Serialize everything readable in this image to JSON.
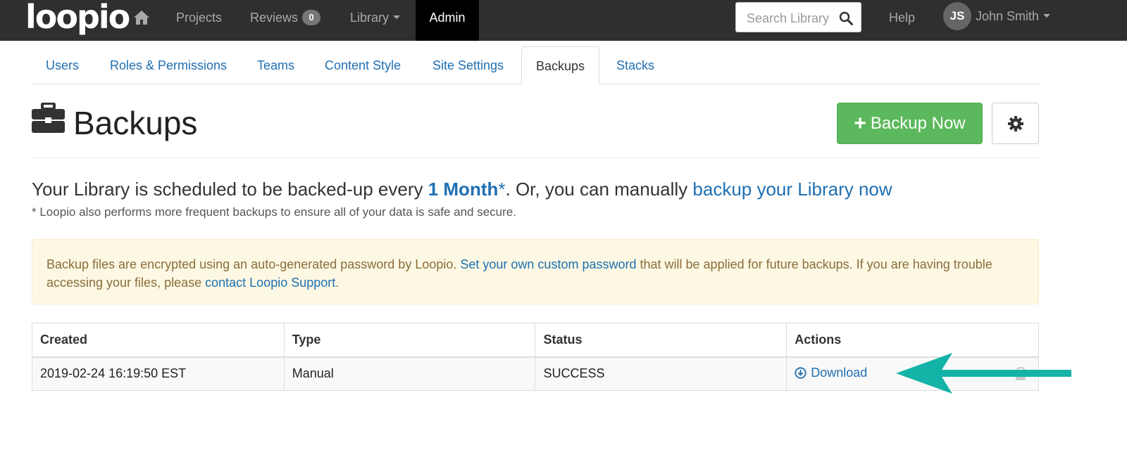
{
  "navbar": {
    "logo": "loopio",
    "items": {
      "projects": "Projects",
      "reviews": "Reviews",
      "reviews_count": "0",
      "library": "Library",
      "admin": "Admin",
      "help": "Help"
    },
    "search": {
      "placeholder": "Search Library"
    },
    "user": {
      "initials": "JS",
      "name": "John Smith"
    },
    "icons": [
      "home-icon",
      "search-icon",
      "chevron-down-icon"
    ]
  },
  "tabs": [
    {
      "label": "Users",
      "active": false
    },
    {
      "label": "Roles & Permissions",
      "active": false
    },
    {
      "label": "Teams",
      "active": false
    },
    {
      "label": "Content Style",
      "active": false
    },
    {
      "label": "Site Settings",
      "active": false
    },
    {
      "label": "Backups",
      "active": true
    },
    {
      "label": "Stacks",
      "active": false
    }
  ],
  "page": {
    "title": "Backups",
    "title_icon": "briefcase-icon",
    "backup_now_label": "Backup Now",
    "settings_icon": "gear-icon"
  },
  "schedule": {
    "prefix": "Your Library is scheduled to be backed-up every ",
    "frequency": "1 Month",
    "asterisk": "*",
    "middle": ". Or, you can manually ",
    "link": "backup your Library now",
    "note": "* Loopio also performs more frequent backups to ensure all of your data is safe and secure."
  },
  "alert": {
    "text1": "Backup files are encrypted using an auto-generated password by Loopio. ",
    "link1": "Set your own custom password",
    "text2": " that will be applied for future backups. If you are having trouble accessing your files, please ",
    "link2": "contact Loopio Support",
    "text3": "."
  },
  "table": {
    "headers": {
      "created": "Created",
      "type": "Type",
      "status": "Status",
      "actions": "Actions"
    },
    "rows": [
      {
        "created": "2019-02-24 16:19:50 EST",
        "type": "Manual",
        "status": "SUCCESS",
        "action": "Download"
      }
    ]
  },
  "colors": {
    "navbar_bg": "#2f2f2f",
    "link": "#1f6fb2",
    "success": "#5cb85c",
    "alert_bg": "#fcf8e3",
    "annotation_arrow": "#14b3a8"
  }
}
